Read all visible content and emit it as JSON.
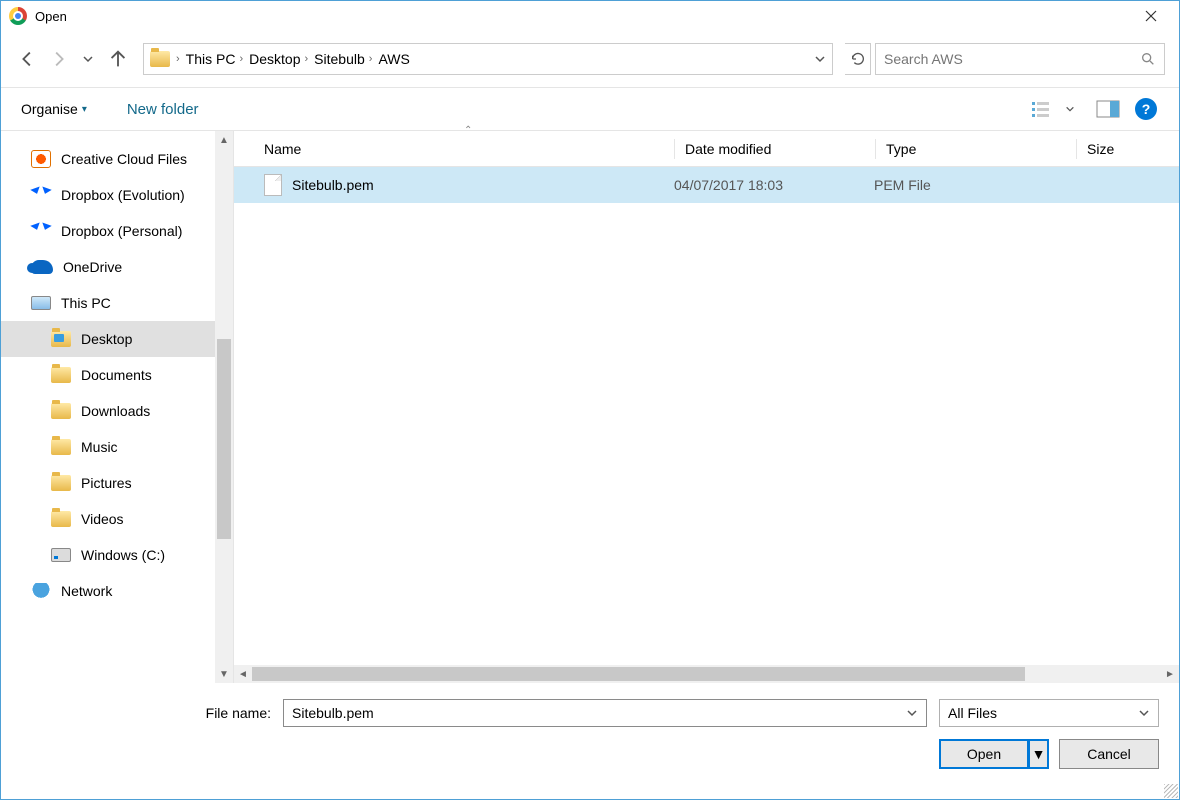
{
  "titlebar": {
    "title": "Open"
  },
  "breadcrumb": [
    "This PC",
    "Desktop",
    "Sitebulb",
    "AWS"
  ],
  "search": {
    "placeholder": "Search AWS"
  },
  "toolbar": {
    "organise": "Organise",
    "newfolder": "New folder"
  },
  "columns": {
    "name": "Name",
    "date": "Date modified",
    "type": "Type",
    "size": "Size"
  },
  "sidebar": [
    {
      "label": "Creative Cloud Files",
      "icon": "cc",
      "indent": 0
    },
    {
      "label": "Dropbox (Evolution)",
      "icon": "db",
      "indent": 0
    },
    {
      "label": "Dropbox (Personal)",
      "icon": "db",
      "indent": 0
    },
    {
      "label": "OneDrive",
      "icon": "od",
      "indent": 0
    },
    {
      "label": "This PC",
      "icon": "pc",
      "indent": 0
    },
    {
      "label": "Desktop",
      "icon": "fld-blue",
      "indent": 1,
      "selected": true
    },
    {
      "label": "Documents",
      "icon": "fld",
      "indent": 1
    },
    {
      "label": "Downloads",
      "icon": "fld",
      "indent": 1
    },
    {
      "label": "Music",
      "icon": "fld",
      "indent": 1
    },
    {
      "label": "Pictures",
      "icon": "fld",
      "indent": 1
    },
    {
      "label": "Videos",
      "icon": "fld",
      "indent": 1
    },
    {
      "label": "Windows (C:)",
      "icon": "drv",
      "indent": 1
    },
    {
      "label": "Network",
      "icon": "net",
      "indent": 0
    }
  ],
  "files": [
    {
      "name": "Sitebulb.pem",
      "date": "04/07/2017 18:03",
      "type": "PEM File",
      "selected": true
    }
  ],
  "footer": {
    "filename_label": "File name:",
    "filename_value": "Sitebulb.pem",
    "filter": "All Files",
    "open": "Open",
    "cancel": "Cancel"
  }
}
